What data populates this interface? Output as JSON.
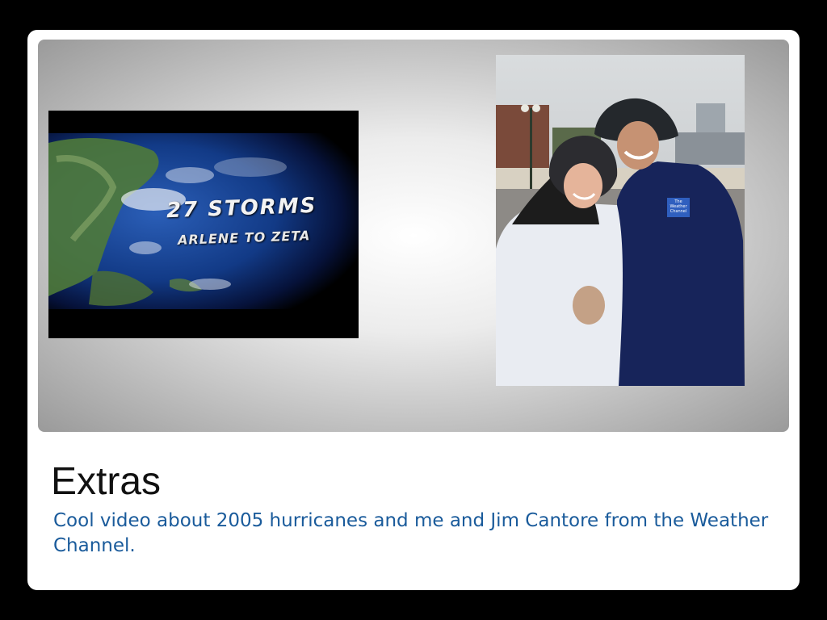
{
  "slide": {
    "title": "Extras",
    "body": "Cool video about 2005 hurricanes and me and Jim Cantore from the Weather Channel."
  },
  "video": {
    "title": "27 STORMS",
    "subtitle": "ARLENE TO ZETA"
  },
  "photo": {
    "jacket_badge": "The Weather Channel"
  },
  "colors": {
    "background": "#000000",
    "slide": "#ffffff",
    "body_text": "#1a5b9b",
    "title_text": "#111111"
  }
}
